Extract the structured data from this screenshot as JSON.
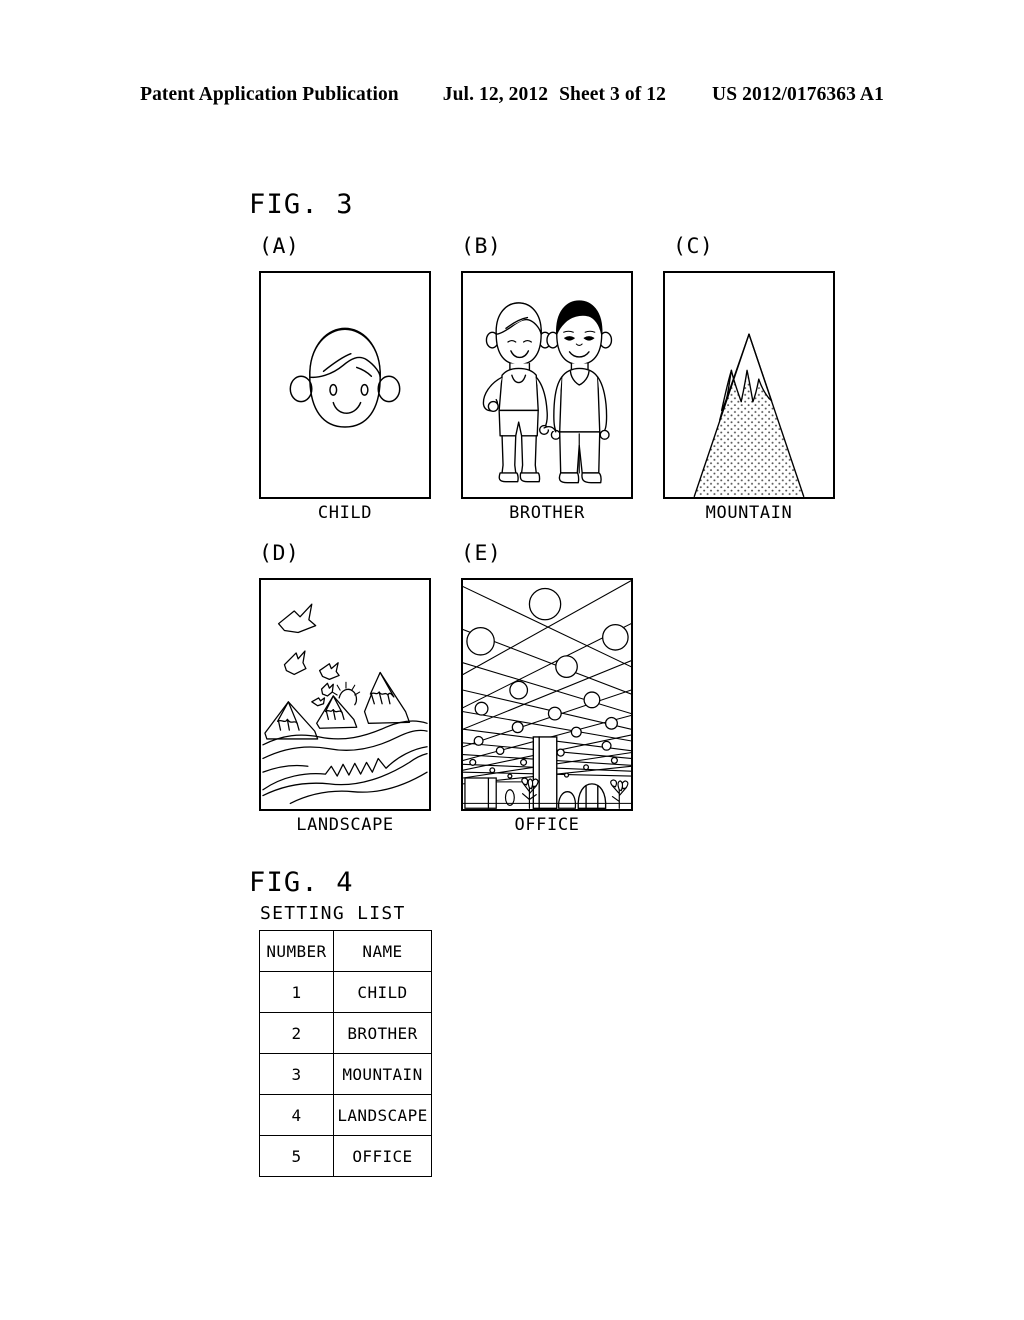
{
  "header": {
    "publication": "Patent Application Publication",
    "date": "Jul. 12, 2012",
    "sheet": "Sheet 3 of 12",
    "doc_number": "US 2012/0176363 A1"
  },
  "figures": [
    {
      "title": "FIG. 3",
      "panels": [
        {
          "label": "(A)",
          "caption": "CHILD",
          "image": "child-face-drawing"
        },
        {
          "label": "(B)",
          "caption": "BROTHER",
          "image": "two-brothers-drawing"
        },
        {
          "label": "(C)",
          "caption": "MOUNTAIN",
          "image": "mountain-drawing"
        },
        {
          "label": "(D)",
          "caption": "LANDSCAPE",
          "image": "landscape-drawing"
        },
        {
          "label": "(E)",
          "caption": "OFFICE",
          "image": "office-interior-drawing"
        }
      ]
    },
    {
      "title": "FIG. 4",
      "table": {
        "caption": "SETTING LIST",
        "columns": [
          "NUMBER",
          "NAME"
        ],
        "rows": [
          [
            "1",
            "CHILD"
          ],
          [
            "2",
            "BROTHER"
          ],
          [
            "3",
            "MOUNTAIN"
          ],
          [
            "4",
            "LANDSCAPE"
          ],
          [
            "5",
            "OFFICE"
          ]
        ]
      }
    }
  ],
  "colors": {
    "ink": "#000000",
    "paper": "#ffffff"
  }
}
